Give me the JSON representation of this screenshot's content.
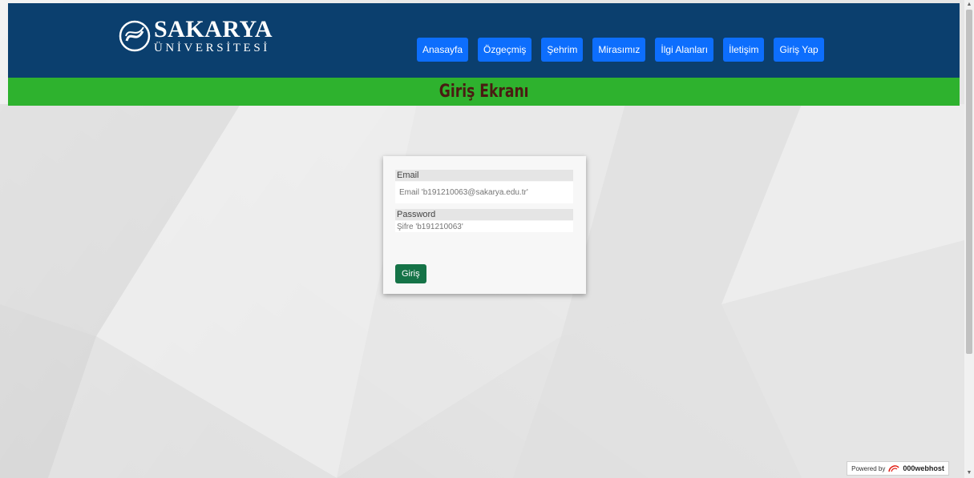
{
  "header": {
    "logo_title": "SAKARYA",
    "logo_subtitle": "ÜNİVERSİTESİ",
    "nav": [
      {
        "label": "Anasayfa"
      },
      {
        "label": "Özgeçmiş"
      },
      {
        "label": "Şehrim"
      },
      {
        "label": "Mirasımız"
      },
      {
        "label": "İlgi Alanları"
      },
      {
        "label": "İletişim"
      },
      {
        "label": "Giriş Yap"
      }
    ]
  },
  "page": {
    "title": "Giriş Ekranı"
  },
  "login_form": {
    "email_label": "Email",
    "email_placeholder": "Email 'b191210063@sakarya.edu.tr'",
    "password_label": "Password",
    "password_placeholder": "Şifre 'b191210063'",
    "submit_label": "Giriş"
  },
  "footer": {
    "powered_by": "Powered by",
    "host_brand": "000webhost"
  },
  "colors": {
    "header_bg": "#0b3f6e",
    "nav_button": "#0d6efd",
    "title_bar": "#2eb22e",
    "title_text": "#4a1b12",
    "submit_button": "#157347"
  },
  "icons": {
    "logo": "sakarya-logo-icon",
    "host": "webhost-logo-icon"
  }
}
